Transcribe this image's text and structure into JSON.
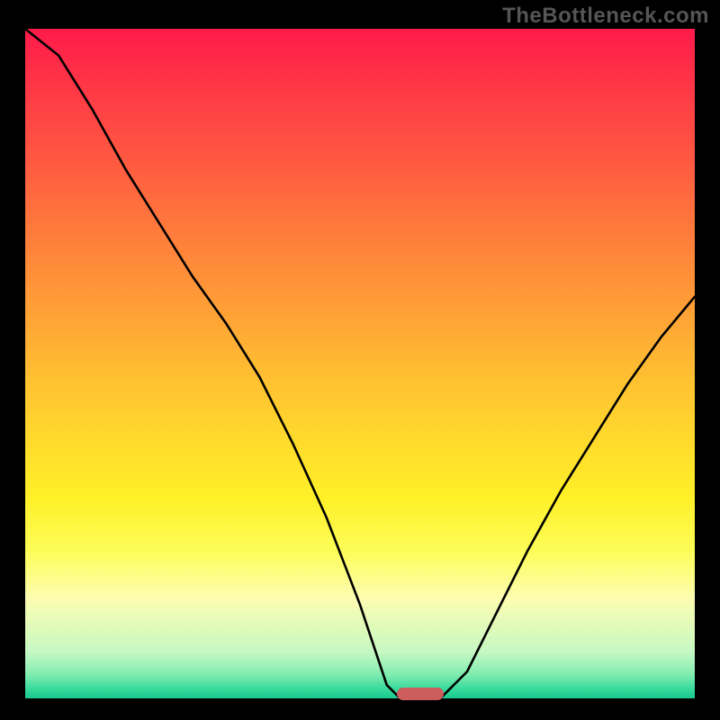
{
  "watermark": "TheBottleneck.com",
  "colors": {
    "background": "#000000",
    "curve": "#000000",
    "marker": "#cd5c5c"
  },
  "gradient_stops": [
    {
      "y": 0.0,
      "color": "#ff1a4a"
    },
    {
      "y": 0.1,
      "color": "#ff3b46"
    },
    {
      "y": 0.2,
      "color": "#ff5a41"
    },
    {
      "y": 0.3,
      "color": "#ff7a3c"
    },
    {
      "y": 0.4,
      "color": "#ff9a37"
    },
    {
      "y": 0.5,
      "color": "#ffb932"
    },
    {
      "y": 0.6,
      "color": "#ffd62d"
    },
    {
      "y": 0.7,
      "color": "#fff028"
    },
    {
      "y": 0.78,
      "color": "#fdfd58"
    },
    {
      "y": 0.85,
      "color": "#fdfdb0"
    },
    {
      "y": 0.93,
      "color": "#c7f8c3"
    },
    {
      "y": 0.965,
      "color": "#7eecb0"
    },
    {
      "y": 0.985,
      "color": "#38db9c"
    },
    {
      "y": 1.0,
      "color": "#18c98e"
    }
  ],
  "chart_data": {
    "type": "line",
    "title": "",
    "xlabel": "",
    "ylabel": "",
    "xlim": [
      0,
      1
    ],
    "ylim": [
      0,
      1
    ],
    "x": [
      0.0,
      0.05,
      0.1,
      0.15,
      0.2,
      0.25,
      0.3,
      0.35,
      0.4,
      0.45,
      0.5,
      0.54,
      0.56,
      0.58,
      0.62,
      0.66,
      0.7,
      0.75,
      0.8,
      0.85,
      0.9,
      0.95,
      1.0
    ],
    "values": [
      1.04,
      0.96,
      0.88,
      0.79,
      0.71,
      0.63,
      0.56,
      0.48,
      0.38,
      0.27,
      0.14,
      0.02,
      0.0,
      0.0,
      0.0,
      0.04,
      0.12,
      0.22,
      0.31,
      0.39,
      0.47,
      0.54,
      0.6
    ],
    "marker": {
      "x_start": 0.56,
      "x_end": 0.62,
      "y": 0.0
    },
    "grid": false,
    "legend": null
  }
}
